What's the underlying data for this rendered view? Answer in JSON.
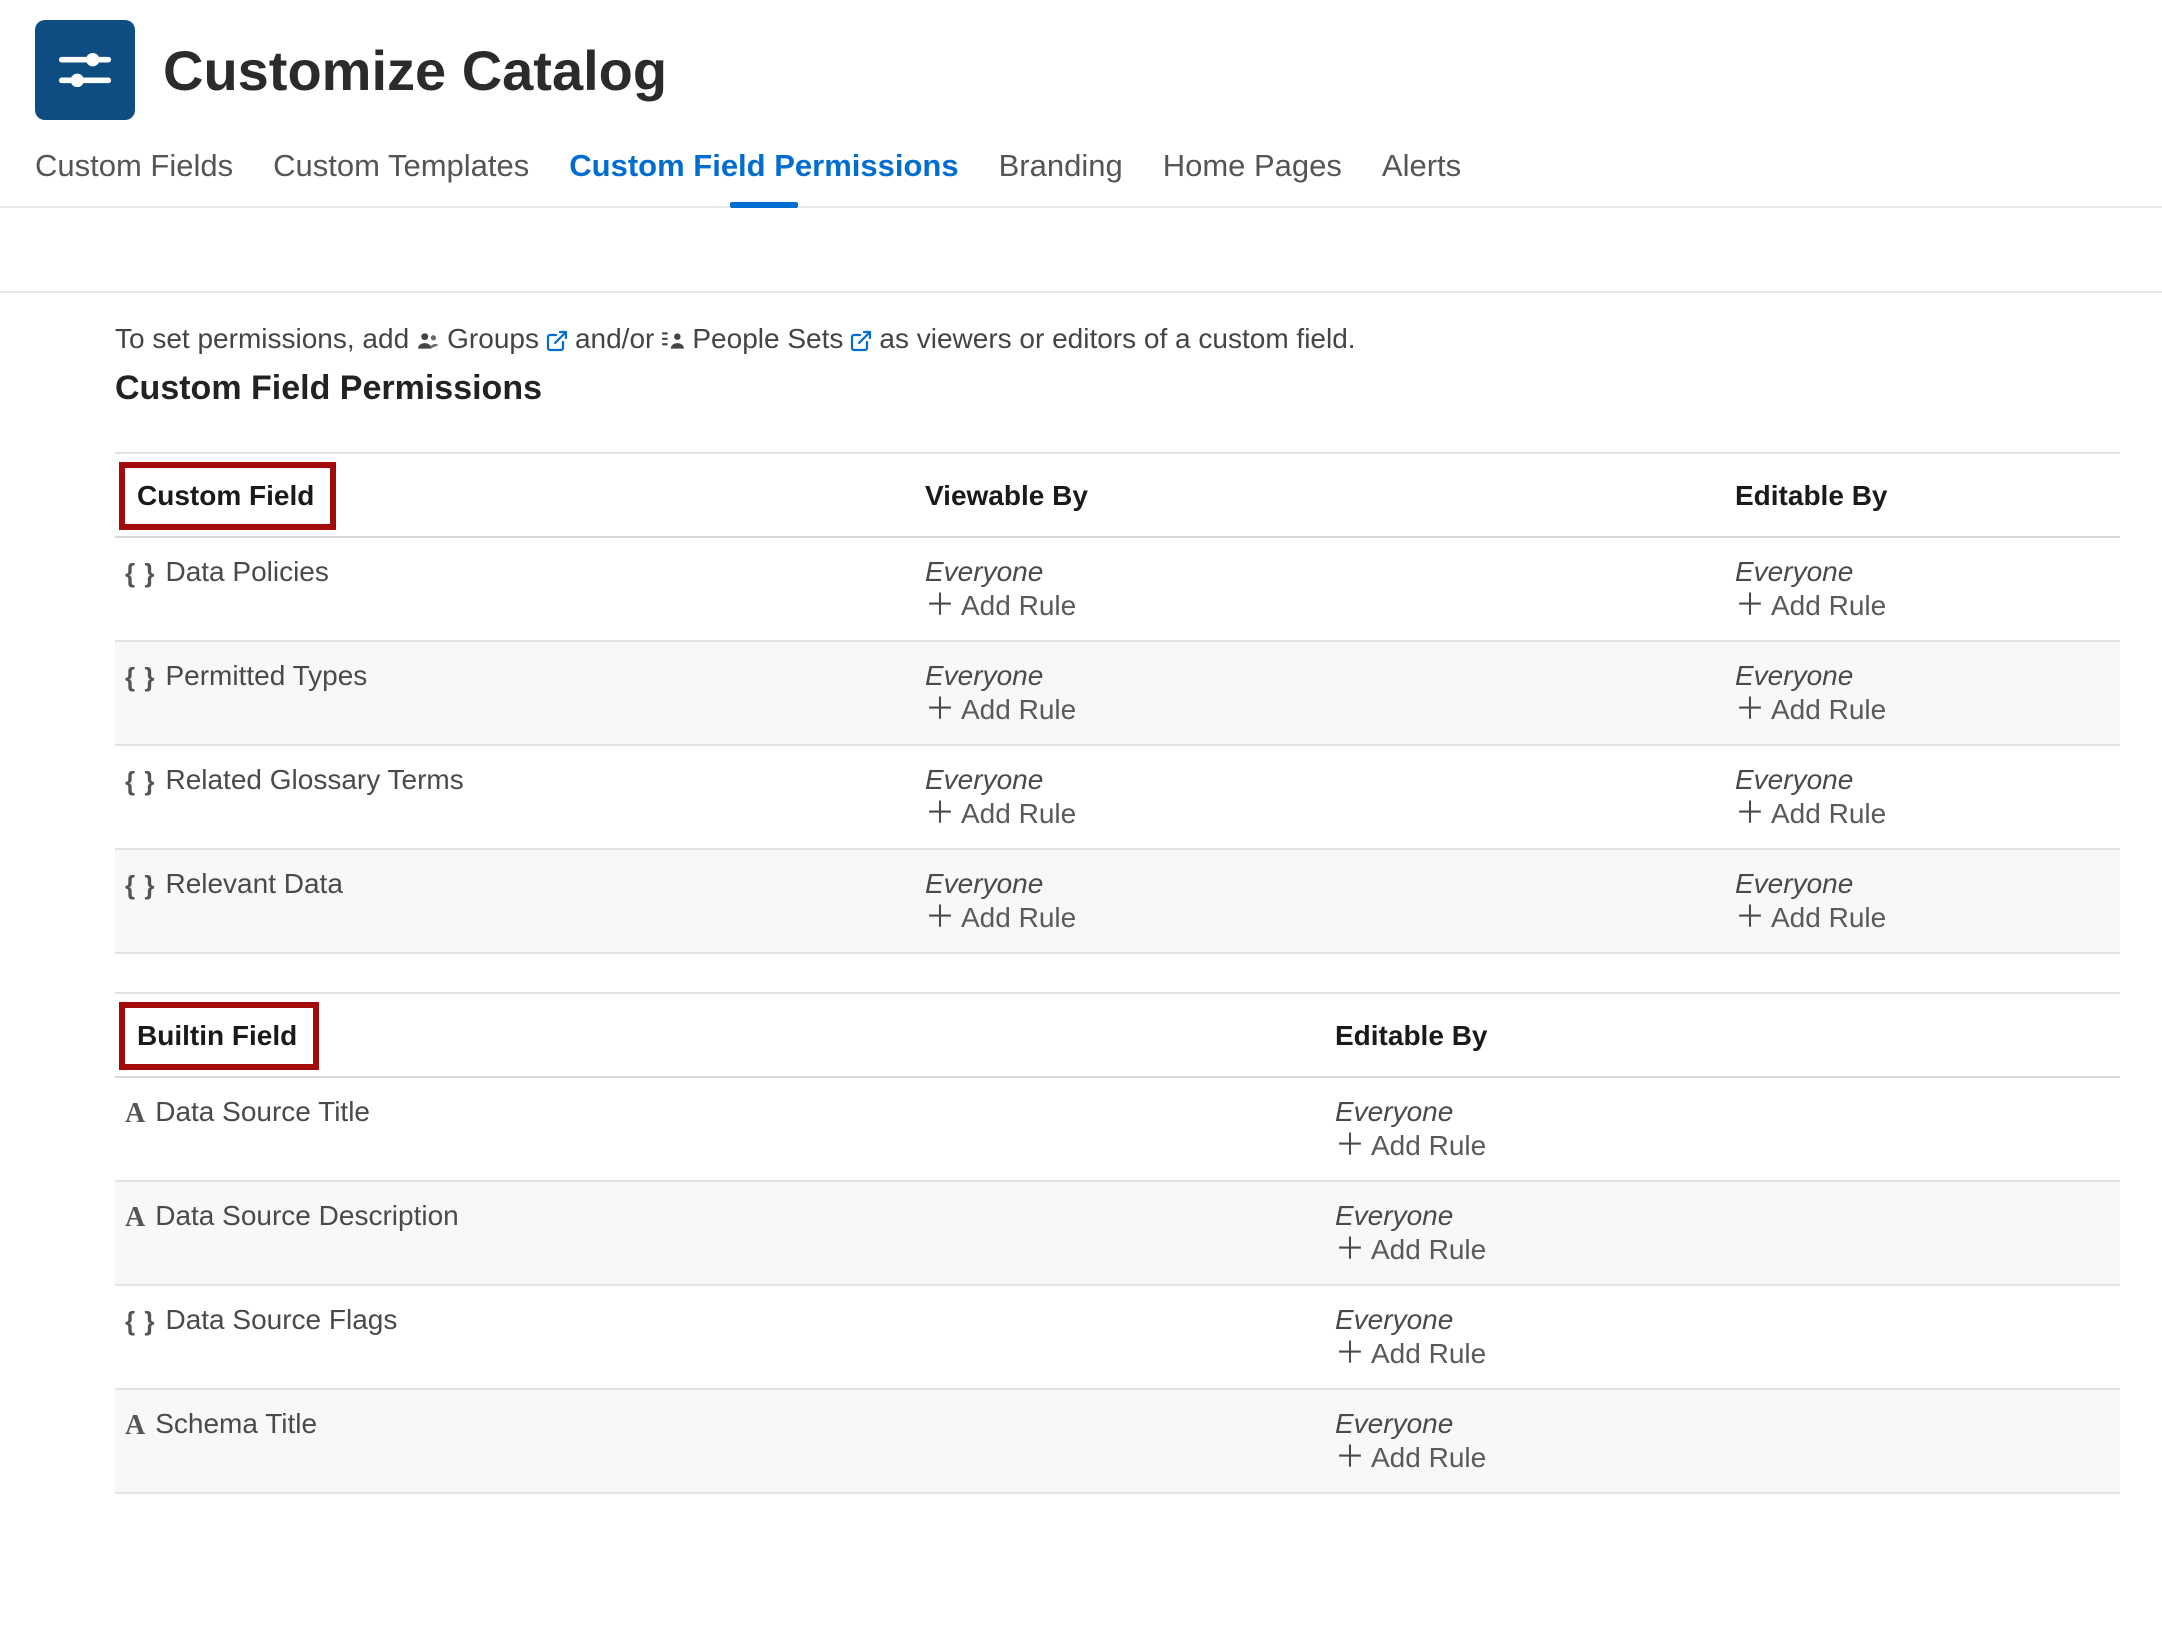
{
  "header": {
    "title": "Customize Catalog"
  },
  "tabs": {
    "items": [
      {
        "label": "Custom Fields",
        "active": false
      },
      {
        "label": "Custom Templates",
        "active": false
      },
      {
        "label": "Custom Field Permissions",
        "active": true
      },
      {
        "label": "Branding",
        "active": false
      },
      {
        "label": "Home Pages",
        "active": false
      },
      {
        "label": "Alerts",
        "active": false
      }
    ]
  },
  "intro": {
    "prefix": "To set permissions, add",
    "groups_label": "Groups",
    "mid": "and/or",
    "people_sets_label": "People Sets",
    "suffix": "as viewers or editors of a custom field."
  },
  "section_title": "Custom Field Permissions",
  "custom_table": {
    "headers": {
      "name": "Custom Field",
      "viewable": "Viewable By",
      "editable": "Editable By"
    },
    "everyone_label": "Everyone",
    "add_rule_label": "Add Rule",
    "rows": [
      {
        "icon": "braces",
        "name": "Data Policies"
      },
      {
        "icon": "braces",
        "name": "Permitted Types"
      },
      {
        "icon": "braces",
        "name": "Related Glossary Terms"
      },
      {
        "icon": "braces",
        "name": "Relevant Data"
      }
    ]
  },
  "builtin_table": {
    "headers": {
      "name": "Builtin Field",
      "editable": "Editable By"
    },
    "everyone_label": "Everyone",
    "add_rule_label": "Add Rule",
    "rows": [
      {
        "icon": "A",
        "name": "Data Source Title"
      },
      {
        "icon": "A",
        "name": "Data Source Description"
      },
      {
        "icon": "braces",
        "name": "Data Source Flags"
      },
      {
        "icon": "A",
        "name": "Schema Title"
      }
    ]
  }
}
